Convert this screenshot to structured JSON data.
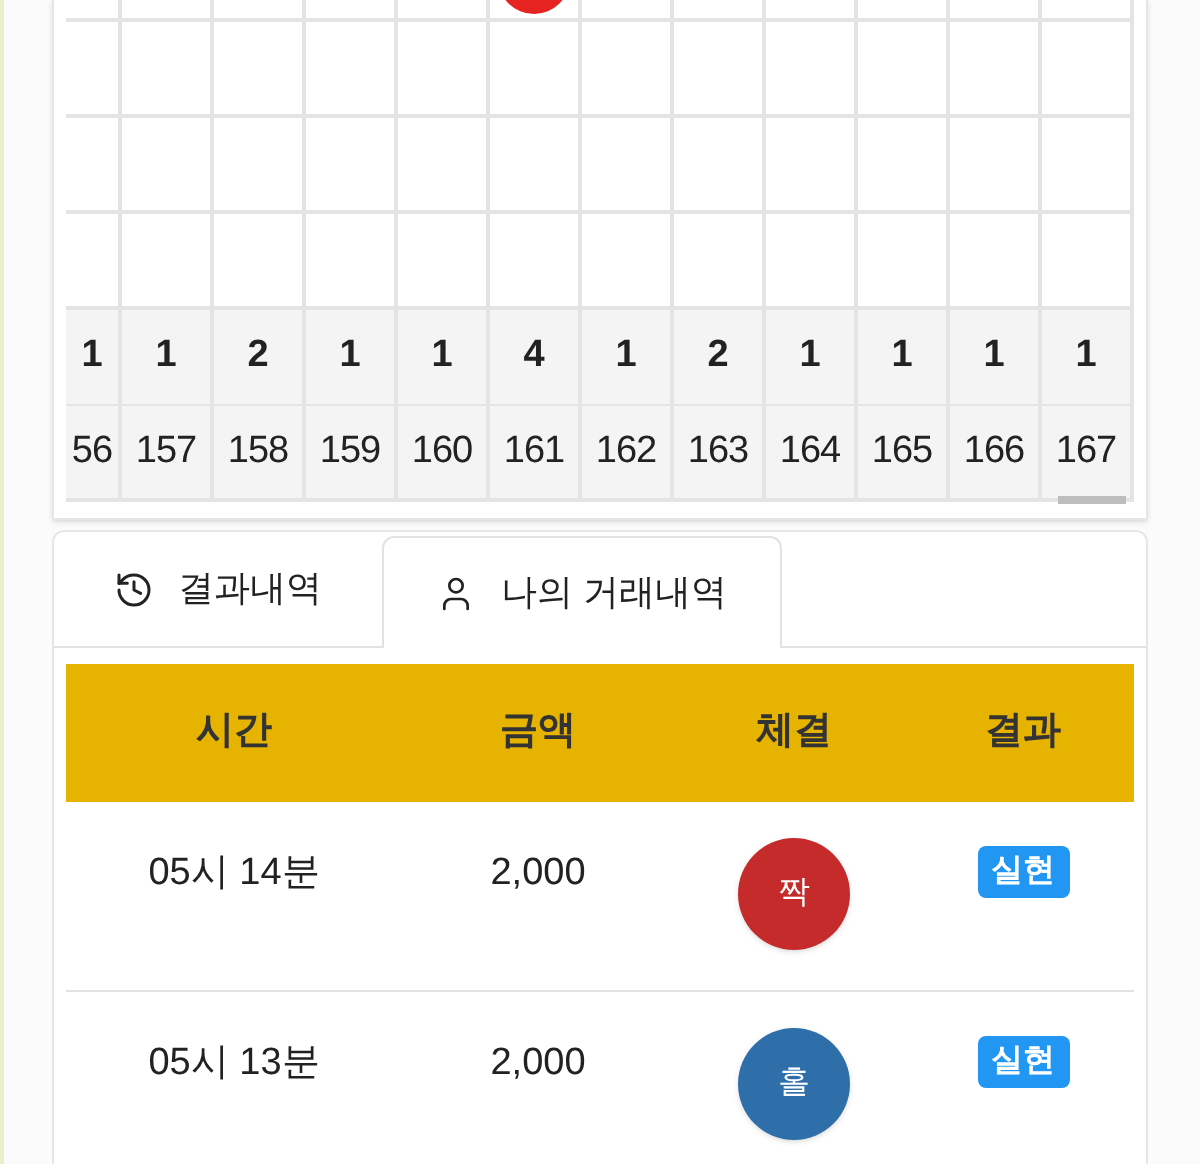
{
  "road": {
    "columns": [
      {
        "count": "1",
        "number": "56",
        "partial": true
      },
      {
        "count": "1",
        "number": "157"
      },
      {
        "count": "2",
        "number": "158"
      },
      {
        "count": "1",
        "number": "159"
      },
      {
        "count": "1",
        "number": "160"
      },
      {
        "count": "4",
        "number": "161",
        "top_mark": {
          "color": "#e52421"
        }
      },
      {
        "count": "1",
        "number": "162"
      },
      {
        "count": "2",
        "number": "163"
      },
      {
        "count": "1",
        "number": "164"
      },
      {
        "count": "1",
        "number": "165"
      },
      {
        "count": "1",
        "number": "166"
      },
      {
        "count": "1",
        "number": "167"
      }
    ]
  },
  "tabs": [
    {
      "label": "결과내역",
      "kind": "history",
      "selected": false
    },
    {
      "label": "나의 거래내역",
      "kind": "user",
      "selected": true
    }
  ],
  "table": {
    "columns": [
      "시간",
      "금액",
      "체결",
      "결과"
    ],
    "rows": [
      {
        "time": "05시 14분",
        "amount": "2,000",
        "fill": {
          "label": "짝",
          "color": "#c62b2b"
        },
        "result": "실현"
      },
      {
        "time": "05시 13분",
        "amount": "2,000",
        "fill": {
          "label": "홀",
          "color": "#2e6faa"
        },
        "result": "실현"
      }
    ]
  }
}
